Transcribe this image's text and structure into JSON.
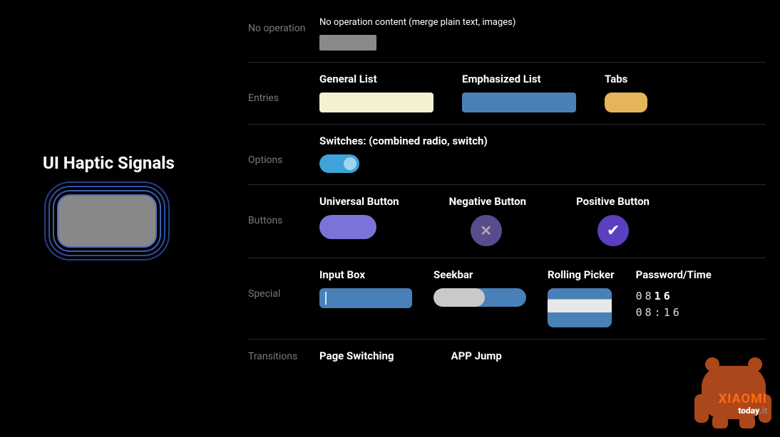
{
  "left": {
    "title": "UI Haptic Signals"
  },
  "rows": {
    "noop": {
      "label": "No operation",
      "caption": "No operation content (merge plain text, images)"
    },
    "entries": {
      "label": "Entries",
      "general": "General List",
      "emphasized": "Emphasized List",
      "tabs": "Tabs"
    },
    "options": {
      "label": "Options",
      "switches": "Switches: (combined radio, switch)"
    },
    "buttons": {
      "label": "Buttons",
      "universal": "Universal Button",
      "negative": "Negative Button",
      "positive": "Positive Button"
    },
    "special": {
      "label": "Special",
      "input": "Input Box",
      "seekbar": "Seekbar",
      "picker": "Rolling Picker",
      "pwtime": "Password/Time",
      "pw_value": "0816",
      "time_value": "08:16"
    },
    "transitions": {
      "label": "Transitions",
      "page": "Page Switching",
      "app": "APP Jump"
    }
  },
  "watermark": {
    "brand": "XIAOMI",
    "site_prefix": "today",
    "site_suffix": ".it"
  }
}
